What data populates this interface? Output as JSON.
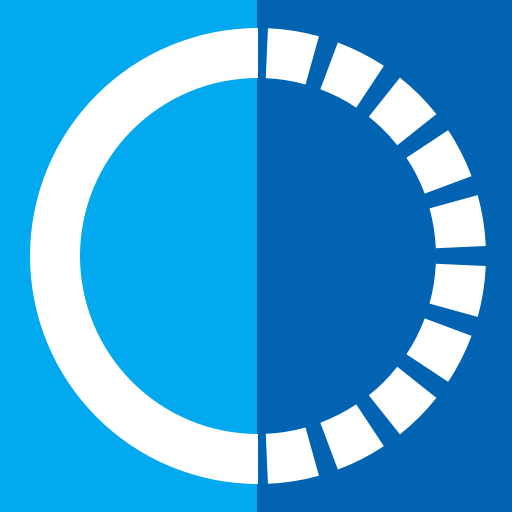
{
  "icon": {
    "name": "half-dashed-circle-icon",
    "colors": {
      "left_panel": "#03A9EF",
      "right_panel": "#0263B3",
      "ring": "#FFFFFF"
    }
  }
}
